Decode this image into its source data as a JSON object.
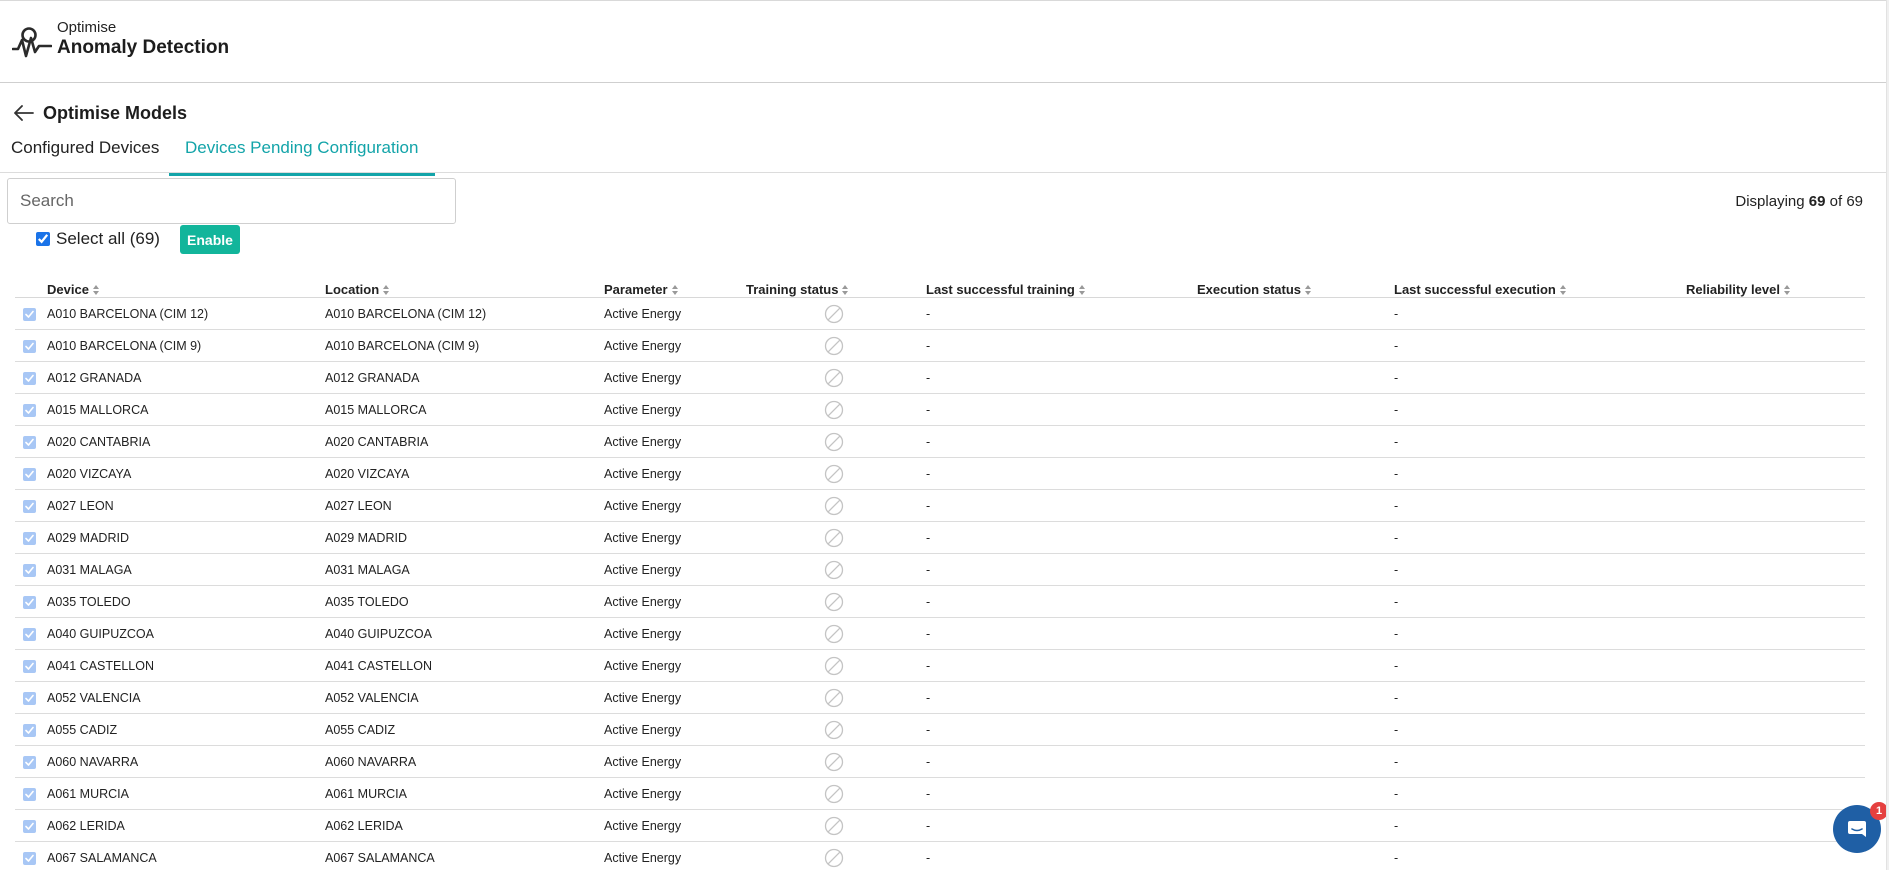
{
  "brand": {
    "product_line": "Optimise",
    "app_name": "Anomaly Detection"
  },
  "page": {
    "title": "Optimise Models"
  },
  "tabs": [
    {
      "label": "Configured Devices",
      "active": false
    },
    {
      "label": "Devices Pending Configuration",
      "active": true
    }
  ],
  "search": {
    "placeholder": "Search",
    "value": ""
  },
  "display_info": {
    "prefix": "Displaying",
    "shown": "69",
    "middle": "of",
    "total": "69"
  },
  "bulk": {
    "select_all_label": "Select all (69)",
    "select_all_checked": true,
    "enable_label": "Enable"
  },
  "table": {
    "columns": [
      "Device",
      "Location",
      "Parameter",
      "Training status",
      "Last successful training",
      "Execution status",
      "Last successful execution",
      "Reliability level"
    ],
    "rows": [
      {
        "device": "A010 BARCELONA (CIM 12)",
        "location": "A010 BARCELONA (CIM 12)",
        "parameter": "Active Energy",
        "training_status": "not-available-icon",
        "last_training": "-",
        "execution_status": "",
        "last_execution": "-",
        "reliability": ""
      },
      {
        "device": "A010 BARCELONA (CIM 9)",
        "location": "A010 BARCELONA (CIM 9)",
        "parameter": "Active Energy",
        "training_status": "not-available-icon",
        "last_training": "-",
        "execution_status": "",
        "last_execution": "-",
        "reliability": ""
      },
      {
        "device": "A012 GRANADA",
        "location": "A012 GRANADA",
        "parameter": "Active Energy",
        "training_status": "not-available-icon",
        "last_training": "-",
        "execution_status": "",
        "last_execution": "-",
        "reliability": ""
      },
      {
        "device": "A015 MALLORCA",
        "location": "A015 MALLORCA",
        "parameter": "Active Energy",
        "training_status": "not-available-icon",
        "last_training": "-",
        "execution_status": "",
        "last_execution": "-",
        "reliability": ""
      },
      {
        "device": "A020 CANTABRIA",
        "location": "A020 CANTABRIA",
        "parameter": "Active Energy",
        "training_status": "not-available-icon",
        "last_training": "-",
        "execution_status": "",
        "last_execution": "-",
        "reliability": ""
      },
      {
        "device": "A020 VIZCAYA",
        "location": "A020 VIZCAYA",
        "parameter": "Active Energy",
        "training_status": "not-available-icon",
        "last_training": "-",
        "execution_status": "",
        "last_execution": "-",
        "reliability": ""
      },
      {
        "device": "A027 LEON",
        "location": "A027 LEON",
        "parameter": "Active Energy",
        "training_status": "not-available-icon",
        "last_training": "-",
        "execution_status": "",
        "last_execution": "-",
        "reliability": ""
      },
      {
        "device": "A029 MADRID",
        "location": "A029 MADRID",
        "parameter": "Active Energy",
        "training_status": "not-available-icon",
        "last_training": "-",
        "execution_status": "",
        "last_execution": "-",
        "reliability": ""
      },
      {
        "device": "A031 MALAGA",
        "location": "A031 MALAGA",
        "parameter": "Active Energy",
        "training_status": "not-available-icon",
        "last_training": "-",
        "execution_status": "",
        "last_execution": "-",
        "reliability": ""
      },
      {
        "device": "A035 TOLEDO",
        "location": "A035 TOLEDO",
        "parameter": "Active Energy",
        "training_status": "not-available-icon",
        "last_training": "-",
        "execution_status": "",
        "last_execution": "-",
        "reliability": ""
      },
      {
        "device": "A040 GUIPUZCOA",
        "location": "A040 GUIPUZCOA",
        "parameter": "Active Energy",
        "training_status": "not-available-icon",
        "last_training": "-",
        "execution_status": "",
        "last_execution": "-",
        "reliability": ""
      },
      {
        "device": "A041 CASTELLON",
        "location": "A041 CASTELLON",
        "parameter": "Active Energy",
        "training_status": "not-available-icon",
        "last_training": "-",
        "execution_status": "",
        "last_execution": "-",
        "reliability": ""
      },
      {
        "device": "A052 VALENCIA",
        "location": "A052 VALENCIA",
        "parameter": "Active Energy",
        "training_status": "not-available-icon",
        "last_training": "-",
        "execution_status": "",
        "last_execution": "-",
        "reliability": ""
      },
      {
        "device": "A055 CADIZ",
        "location": "A055 CADIZ",
        "parameter": "Active Energy",
        "training_status": "not-available-icon",
        "last_training": "-",
        "execution_status": "",
        "last_execution": "-",
        "reliability": ""
      },
      {
        "device": "A060 NAVARRA",
        "location": "A060 NAVARRA",
        "parameter": "Active Energy",
        "training_status": "not-available-icon",
        "last_training": "-",
        "execution_status": "",
        "last_execution": "-",
        "reliability": ""
      },
      {
        "device": "A061 MURCIA",
        "location": "A061 MURCIA",
        "parameter": "Active Energy",
        "training_status": "not-available-icon",
        "last_training": "-",
        "execution_status": "",
        "last_execution": "-",
        "reliability": ""
      },
      {
        "device": "A062 LERIDA",
        "location": "A062 LERIDA",
        "parameter": "Active Energy",
        "training_status": "not-available-icon",
        "last_training": "-",
        "execution_status": "",
        "last_execution": "-",
        "reliability": ""
      },
      {
        "device": "A067 SALAMANCA",
        "location": "A067 SALAMANCA",
        "parameter": "Active Energy",
        "training_status": "not-available-icon",
        "last_training": "-",
        "execution_status": "",
        "last_execution": "-",
        "reliability": ""
      }
    ]
  },
  "chat": {
    "badge_count": "1"
  },
  "colors": {
    "accent": "#13a4a9",
    "enable_button": "#12b59b",
    "chat_button": "#1f5fa5",
    "badge": "#e5403f",
    "row_checkbox": "#a8c7f5"
  }
}
